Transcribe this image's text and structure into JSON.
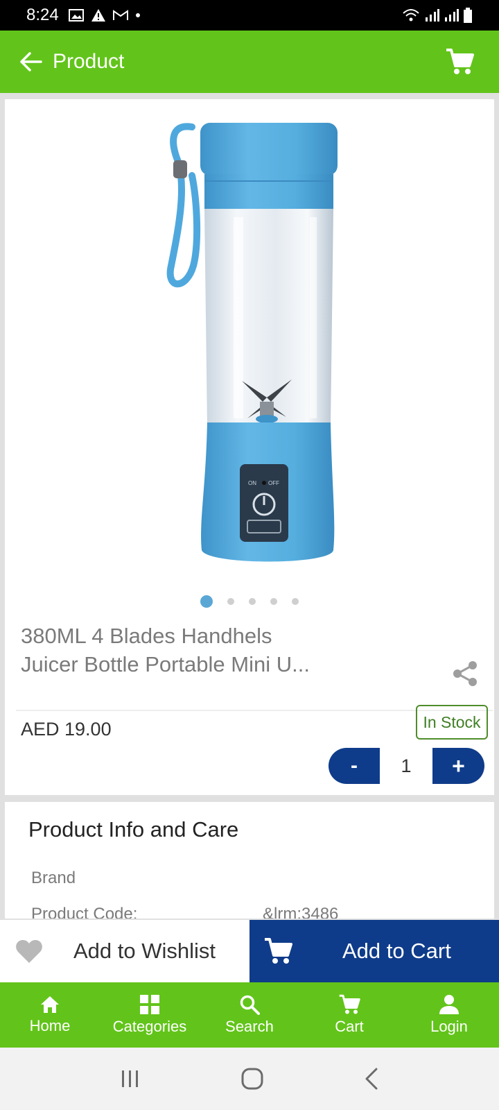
{
  "status_bar": {
    "time": "8:24"
  },
  "app_bar": {
    "title": "Product",
    "back_icon": "arrow-left-icon",
    "cart_icon": "shopping-cart-icon"
  },
  "product": {
    "title_line1": "380ML 4 Blades Handhels",
    "title_line2": "Juicer Bottle Portable Mini U...",
    "price": "AED 19.00",
    "stock_status": "In Stock",
    "quantity": "1",
    "minus_label": "-",
    "plus_label": "+",
    "image_count": 5,
    "active_image": 1,
    "colors": {
      "bottle": "#5ab0e0",
      "accent": "#62c41a",
      "primary": "#0f3c8a"
    }
  },
  "info": {
    "heading": "Product Info and Care",
    "rows": [
      {
        "label": "Brand",
        "value": ""
      },
      {
        "label": "Product Code:",
        "value": "&lrm;3486"
      }
    ]
  },
  "actions": {
    "wishlist_label": "Add to Wishlist",
    "cart_label": "Add to Cart"
  },
  "bottom_nav": {
    "items": [
      {
        "label": "Home",
        "icon": "home-icon"
      },
      {
        "label": "Categories",
        "icon": "grid-icon"
      },
      {
        "label": "Search",
        "icon": "search-icon"
      },
      {
        "label": "Cart",
        "icon": "cart-icon"
      },
      {
        "label": "Login",
        "icon": "person-icon"
      }
    ]
  }
}
